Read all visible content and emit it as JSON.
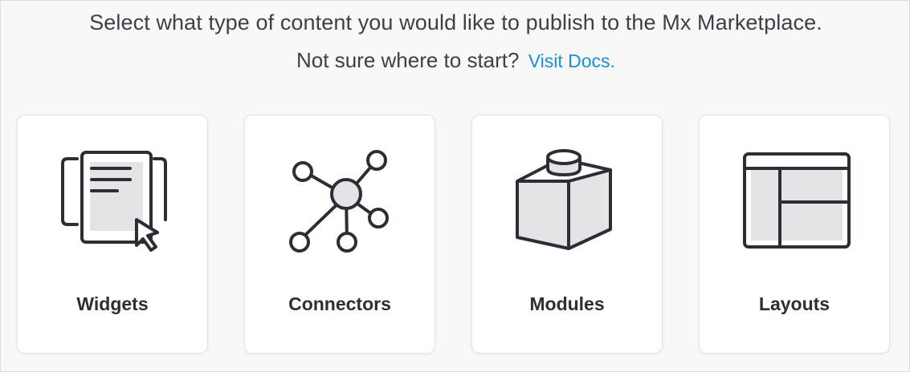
{
  "header": {
    "title": "Select what type of content you would like to publish to the Mx Marketplace.",
    "subtitle": "Not sure where to start?",
    "docs_link": "Visit Docs."
  },
  "cards": [
    {
      "label": "Widgets",
      "icon": "widget-icon"
    },
    {
      "label": "Connectors",
      "icon": "connector-network-icon"
    },
    {
      "label": "Modules",
      "icon": "module-cube-icon"
    },
    {
      "label": "Layouts",
      "icon": "layout-grid-icon"
    }
  ],
  "colors": {
    "text": "#3c4148",
    "link": "#1a8fd6",
    "icon_stroke": "#2b2e35",
    "icon_fill": "#e4e4e6"
  }
}
